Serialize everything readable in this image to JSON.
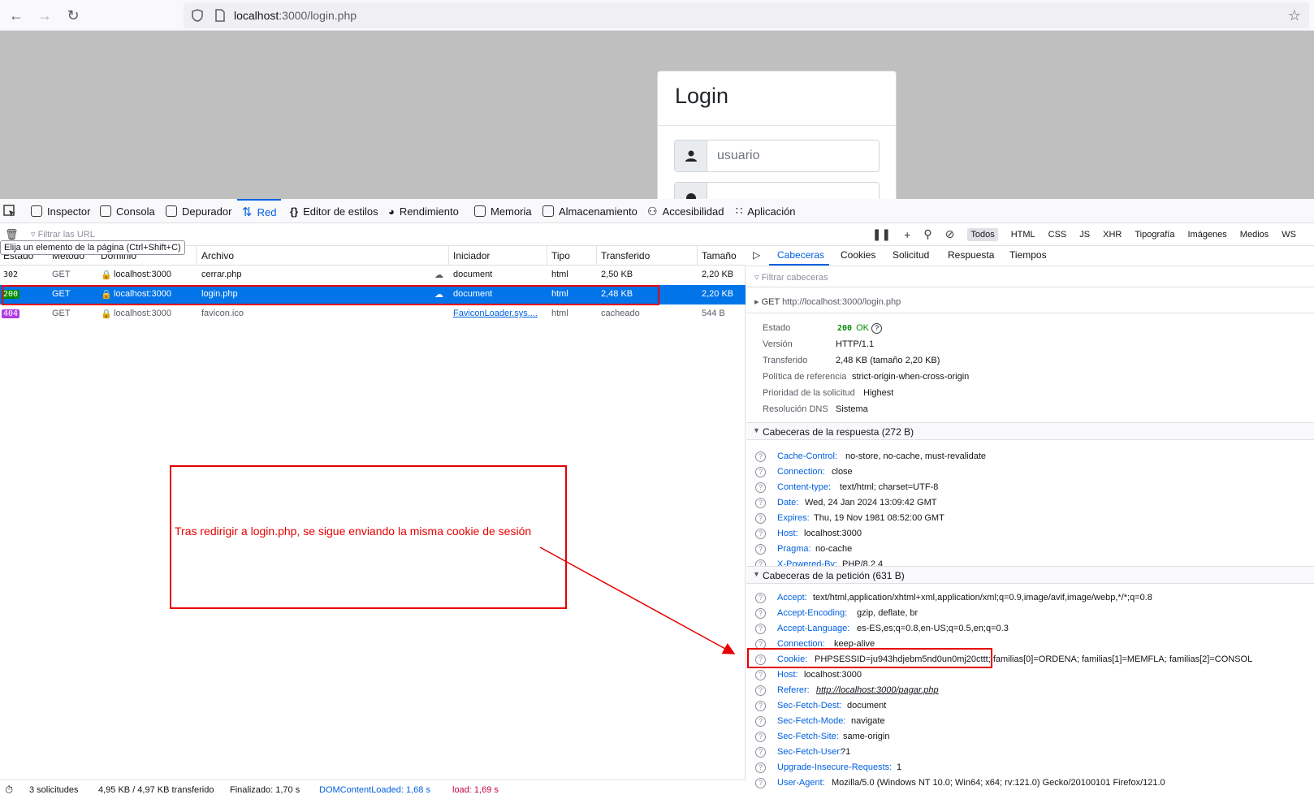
{
  "browser": {
    "url_host": "localhost",
    "url_rest": ":3000/login.php",
    "back_icon": "arrow-left-icon",
    "forward_icon": "arrow-right-icon",
    "reload_icon": "reload-icon"
  },
  "page": {
    "login_title": "Login",
    "username_placeholder": "usuario"
  },
  "devtools": {
    "tabs": [
      {
        "label": "Inspector"
      },
      {
        "label": "Consola"
      },
      {
        "label": "Depurador"
      },
      {
        "label": "Red"
      },
      {
        "label": "Editor de estilos"
      },
      {
        "label": "Rendimiento"
      },
      {
        "label": "Memoria"
      },
      {
        "label": "Almacenamiento"
      },
      {
        "label": "Accesibilidad"
      },
      {
        "label": "Aplicación"
      }
    ],
    "filter_placeholder": "Filtrar las URL",
    "tooltip": "Elija un elemento de la página (Ctrl+Shift+C)",
    "type_filters": [
      "Todos",
      "HTML",
      "CSS",
      "JS",
      "XHR",
      "Tipografía",
      "Imágenes",
      "Medios",
      "WS"
    ],
    "columns": [
      "Estado",
      "Método",
      "Dominio",
      "Archivo",
      "Iniciador",
      "Tipo",
      "Transferido",
      "Tamaño"
    ],
    "requests": [
      {
        "status": "302",
        "method": "GET",
        "domain": "localhost:3000",
        "file": "cerrar.php",
        "initiator": "document",
        "type": "html",
        "transferred": "2,50 KB",
        "size": "2,20 KB"
      },
      {
        "status": "200",
        "method": "GET",
        "domain": "localhost:3000",
        "file": "login.php",
        "initiator": "document",
        "type": "html",
        "transferred": "2,48 KB",
        "size": "2,20 KB"
      },
      {
        "status": "404",
        "method": "GET",
        "domain": "localhost:3000",
        "file": "favicon.ico",
        "initiator": "FaviconLoader.sys....",
        "type": "html",
        "transferred": "cacheado",
        "size": "544 B"
      }
    ],
    "status_bar": {
      "requests": "3 solicitudes",
      "transferred": "4,95 KB / 4,97 KB transferido",
      "finished": "Finalizado: 1,70 s",
      "dom": "DOMContentLoaded: 1,68 s",
      "load": "load: 1,69 s"
    }
  },
  "details": {
    "tabs": [
      "Cabeceras",
      "Cookies",
      "Solicitud",
      "Respuesta",
      "Tiempos"
    ],
    "filter_placeholder": "Filtrar cabeceras",
    "summary_method": "GET",
    "summary_url": "http://localhost:3000/login.php",
    "info": [
      {
        "k": "Estado",
        "v": "OK",
        "code": "200"
      },
      {
        "k": "Versión",
        "v": "HTTP/1.1"
      },
      {
        "k": "Transferido",
        "v": "2,48 KB (tamaño 2,20 KB)"
      },
      {
        "k": "Política de referencia",
        "v": "strict-origin-when-cross-origin"
      },
      {
        "k": "Prioridad de la solicitud",
        "v": "Highest"
      },
      {
        "k": "Resolución DNS",
        "v": "Sistema"
      }
    ],
    "response_title": "Cabeceras de la respuesta (272 B)",
    "response_headers": [
      {
        "n": "Cache-Control:",
        "v": "no-store, no-cache, must-revalidate"
      },
      {
        "n": "Connection:",
        "v": "close"
      },
      {
        "n": "Content-type:",
        "v": "text/html; charset=UTF-8"
      },
      {
        "n": "Date:",
        "v": "Wed, 24 Jan 2024 13:09:42 GMT"
      },
      {
        "n": "Expires:",
        "v": "Thu, 19 Nov 1981 08:52:00 GMT"
      },
      {
        "n": "Host:",
        "v": "localhost:3000"
      },
      {
        "n": "Pragma:",
        "v": "no-cache"
      },
      {
        "n": "X-Powered-By:",
        "v": "PHP/8.2.4"
      }
    ],
    "request_title": "Cabeceras de la petición (631 B)",
    "request_headers": [
      {
        "n": "Accept:",
        "v": "text/html,application/xhtml+xml,application/xml;q=0.9,image/avif,image/webp,*/*;q=0.8"
      },
      {
        "n": "Accept-Encoding:",
        "v": "gzip, deflate, br"
      },
      {
        "n": "Accept-Language:",
        "v": "es-ES,es;q=0.8,en-US;q=0.5,en;q=0.3"
      },
      {
        "n": "Connection:",
        "v": "keep-alive"
      },
      {
        "n": "Cookie:",
        "v": "PHPSESSID=ju943hdjebm5nd0un0mj20cttt; familias[0]=ORDENA; familias[1]=MEMFLA; familias[2]=CONSOL"
      },
      {
        "n": "Host:",
        "v": "localhost:3000"
      },
      {
        "n": "Referer:",
        "v": "http://localhost:3000/pagar.php"
      },
      {
        "n": "Sec-Fetch-Dest:",
        "v": "document"
      },
      {
        "n": "Sec-Fetch-Mode:",
        "v": "navigate"
      },
      {
        "n": "Sec-Fetch-Site:",
        "v": "same-origin"
      },
      {
        "n": "Sec-Fetch-User:",
        "v": "?1"
      },
      {
        "n": "Upgrade-Insecure-Requests:",
        "v": "1"
      },
      {
        "n": "User-Agent:",
        "v": "Mozilla/5.0 (Windows NT 10.0; Win64; x64; rv:121.0) Gecko/20100101 Firefox/121.0"
      }
    ]
  },
  "annotation": {
    "text": "Tras redirigir a login.php, se sigue enviando la misma cookie de sesión",
    "color": "#e60000"
  }
}
